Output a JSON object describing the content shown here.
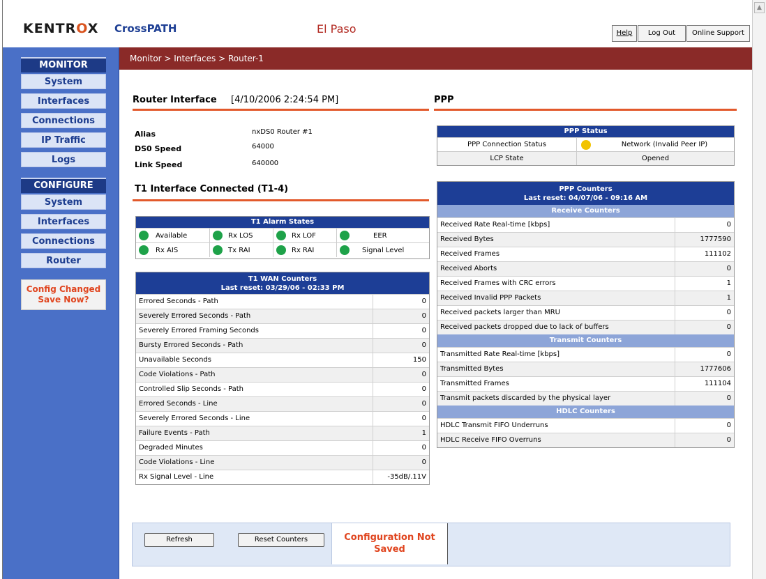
{
  "header": {
    "logo": "KENTROX",
    "product": "CrossPATH",
    "site": "El Paso",
    "buttons": [
      "Help",
      "Log Out",
      "Online Support"
    ]
  },
  "breadcrumb": "Monitor >  Interfaces  >  Router-1",
  "sidebar": {
    "monitor_title": "MONITOR",
    "monitor_items": [
      "System",
      "Interfaces",
      "Connections",
      "IP Traffic",
      "Logs"
    ],
    "configure_title": "CONFIGURE",
    "configure_items": [
      "System",
      "Interfaces",
      "Connections",
      "Router"
    ],
    "config_changed": "Config Changed",
    "save_now": "Save Now?"
  },
  "router": {
    "title": "Router Interface",
    "timestamp": "[4/10/2006 2:24:54 PM]",
    "fields": [
      {
        "label": "Alias",
        "value": "nxDS0 Router #1"
      },
      {
        "label": "DS0 Speed",
        "value": "64000"
      },
      {
        "label": "Link Speed",
        "value": "640000"
      }
    ]
  },
  "t1_title": "T1 Interface Connected (T1-4)",
  "alarm": {
    "title": "T1 Alarm States",
    "items": [
      "Available",
      "Rx LOS",
      "Rx LOF",
      "EER",
      "Rx AIS",
      "Tx RAI",
      "Rx RAI",
      "Signal Level"
    ]
  },
  "wan": {
    "title": "T1 WAN Counters",
    "reset": "Last reset: 03/29/06 - 02:33 PM",
    "rows": [
      [
        "Errored Seconds - Path",
        "0"
      ],
      [
        "Severely Errored Seconds - Path",
        "0"
      ],
      [
        "Severely Errored Framing Seconds",
        "0"
      ],
      [
        "Bursty Errored Seconds - Path",
        "0"
      ],
      [
        "Unavailable Seconds",
        "150"
      ],
      [
        "Code Violations - Path",
        "0"
      ],
      [
        "Controlled Slip Seconds - Path",
        "0"
      ],
      [
        "Errored Seconds - Line",
        "0"
      ],
      [
        "Severely Errored Seconds - Line",
        "0"
      ],
      [
        "Failure Events - Path",
        "1"
      ],
      [
        "Degraded Minutes",
        "0"
      ],
      [
        "Code Violations - Line",
        "0"
      ],
      [
        "Rx Signal Level - Line",
        "-35dB/.11V"
      ]
    ]
  },
  "ppp": {
    "title": "PPP",
    "status_title": "PPP Status",
    "status_rows": [
      [
        "PPP Connection Status",
        "Network (Invalid Peer IP)"
      ],
      [
        "LCP State",
        "Opened"
      ]
    ],
    "counters_title": "PPP Counters",
    "counters_reset": "Last reset: 04/07/06 - 09:16 AM",
    "receive_title": "Receive Counters",
    "receive_rows": [
      [
        "Received Rate Real-time [kbps]",
        "0"
      ],
      [
        "Received Bytes",
        "1777590"
      ],
      [
        "Received Frames",
        "111102"
      ],
      [
        "Received Aborts",
        "0"
      ],
      [
        "Received Frames with CRC errors",
        "1"
      ],
      [
        "Received Invalid PPP Packets",
        "1"
      ],
      [
        "Received packets larger than MRU",
        "0"
      ],
      [
        "Received packets dropped due to lack of buffers",
        "0"
      ]
    ],
    "transmit_title": "Transmit Counters",
    "transmit_rows": [
      [
        "Transmitted Rate Real-time [kbps]",
        "0"
      ],
      [
        "Transmitted Bytes",
        "1777606"
      ],
      [
        "Transmitted Frames",
        "111104"
      ],
      [
        "Transmit packets discarded by the physical layer",
        "0"
      ]
    ],
    "hdlc_title": "HDLC Counters",
    "hdlc_rows": [
      [
        "HDLC Transmit FIFO Underruns",
        "0"
      ],
      [
        "HDLC Receive FIFO Overruns",
        "0"
      ]
    ]
  },
  "footer": {
    "refresh": "Refresh",
    "reset": "Reset Counters",
    "message": "Configuration Not Saved"
  },
  "colors": {
    "sidebar": "#4a70c7",
    "redbar": "#8a2a28",
    "table_header": "#1d3e96",
    "alarm_ok": "#1ea249",
    "status_warn": "#f2c300"
  }
}
